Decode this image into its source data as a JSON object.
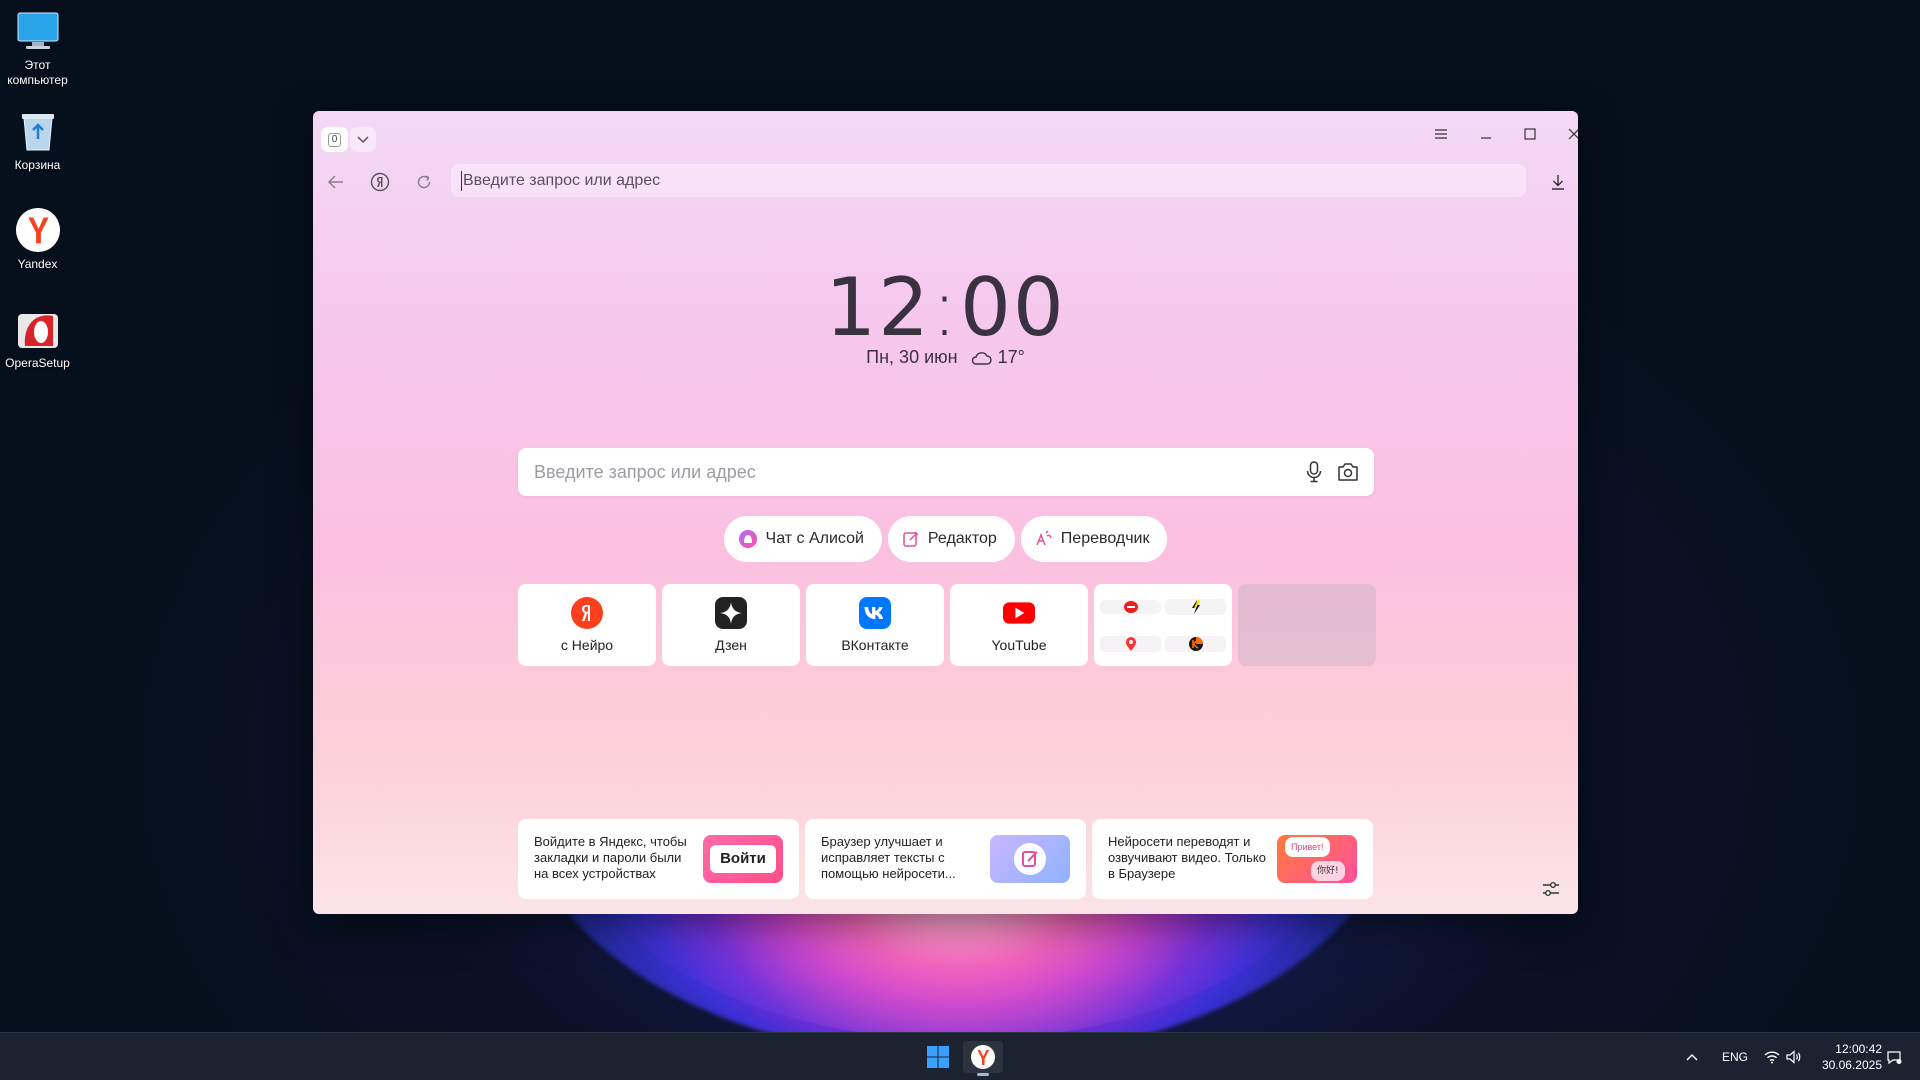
{
  "desktop": {
    "icons": [
      {
        "label": "Этот компьютер"
      },
      {
        "label": "Корзина"
      },
      {
        "label": "Yandex"
      },
      {
        "label": "OperaSetup"
      }
    ]
  },
  "browser": {
    "tab_count": "0",
    "address": {
      "placeholder": "Введите запрос или адрес",
      "value": ""
    },
    "newtab": {
      "time_hours": "12",
      "time_minutes": "00",
      "date": "Пн, 30 июн",
      "temperature": "17°",
      "search_placeholder": "Введите запрос или адрес",
      "pills": [
        {
          "label": "Чат с Алисой",
          "icon": "alice-icon"
        },
        {
          "label": "Редактор",
          "icon": "editor-icon"
        },
        {
          "label": "Переводчик",
          "icon": "translator-icon"
        }
      ],
      "tiles": [
        {
          "label": "с Нейро",
          "icon": "yandex-neuro-icon",
          "color": "#fc3f1d"
        },
        {
          "label": "Дзен",
          "icon": "dzen-icon",
          "color": "#222222"
        },
        {
          "label": "ВКонтакте",
          "icon": "vk-icon",
          "color": "#0077ff"
        },
        {
          "label": "YouTube",
          "icon": "youtube-icon",
          "color": "#ff0000"
        }
      ],
      "promos": [
        {
          "text": "Войдите в Яндекс, чтобы закладки и пароли были на всех устройствах",
          "button": "Войти"
        },
        {
          "text": "Браузер улучшает и исправляет тексты с помощью нейросети..."
        },
        {
          "text": "Нейросети переводят и озвучивают видео. Только в Браузере",
          "bubble1": "Привет!",
          "bubble2": "你好!"
        }
      ]
    }
  },
  "taskbar": {
    "lang": "ENG",
    "time": "12:00:42",
    "date": "30.06.2025"
  },
  "colors": {
    "accent_yandex": "#fc3f1d",
    "taskbar_bg": "#1c2330"
  }
}
